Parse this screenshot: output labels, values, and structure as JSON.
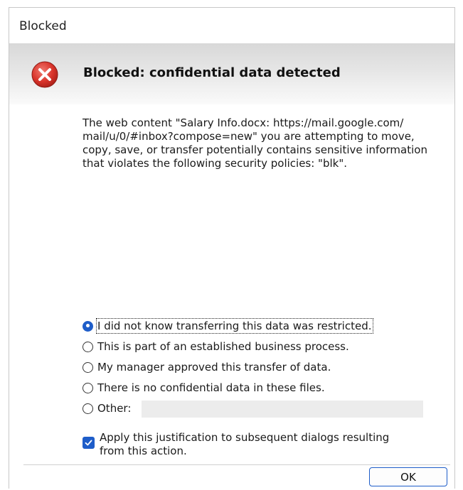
{
  "window": {
    "title": "Blocked"
  },
  "header": {
    "heading": "Blocked: confidential data detected",
    "icon": "error-icon"
  },
  "message": "The web content \"Salary Info.docx: https://mail.google.com/ mail/u/0/#inbox?compose=new\" you are attempting to move, copy, save, or transfer potentially contains sensitive information that violates the following security policies: \"blk\".",
  "options": [
    {
      "label": "I did not know transferring this data was restricted.",
      "selected": true
    },
    {
      "label": "This is part of an established business process.",
      "selected": false
    },
    {
      "label": "My manager approved this transfer of data.",
      "selected": false
    },
    {
      "label": "There is no confidential data in these files.",
      "selected": false
    },
    {
      "label": "Other:",
      "selected": false
    }
  ],
  "other_input": {
    "value": ""
  },
  "apply_checkbox": {
    "label": "Apply this justification to subsequent dialogs resulting from this action.",
    "checked": true
  },
  "buttons": {
    "ok": "OK"
  },
  "colors": {
    "accent": "#1e5dc9",
    "error_red": "#d9342b"
  }
}
